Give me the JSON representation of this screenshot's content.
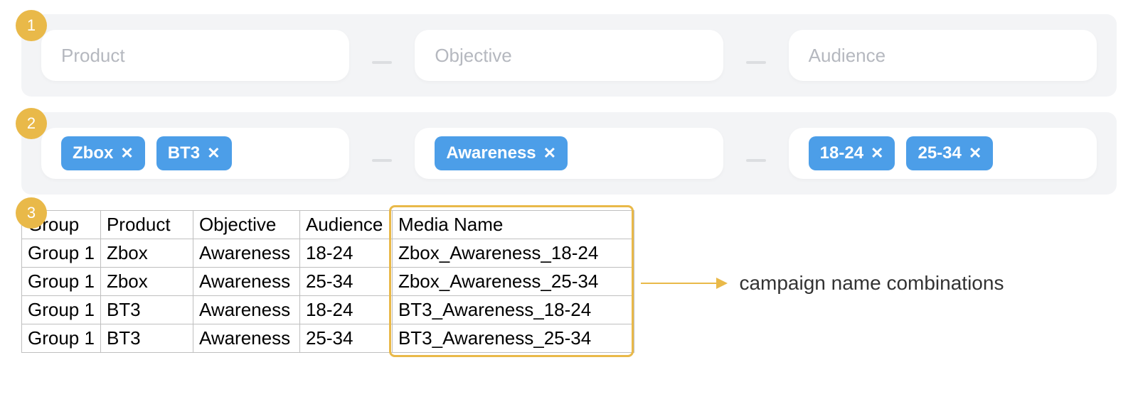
{
  "steps": {
    "s1": "1",
    "s2": "2",
    "s3": "3"
  },
  "row1": {
    "product_ph": "Product",
    "objective_ph": "Objective",
    "audience_ph": "Audience"
  },
  "row2": {
    "product_chips": [
      "Zbox",
      "BT3"
    ],
    "objective_chips": [
      "Awareness"
    ],
    "audience_chips": [
      "18-24",
      "25-34"
    ]
  },
  "table": {
    "headers": {
      "group": "Group",
      "product": "Product",
      "objective": "Objective",
      "audience": "Audience",
      "media": "Media Name"
    },
    "rows": [
      {
        "group": "Group 1",
        "product": "Zbox",
        "objective": "Awareness",
        "audience": "18-24",
        "media": "Zbox_Awareness_18-24"
      },
      {
        "group": "Group 1",
        "product": "Zbox",
        "objective": "Awareness",
        "audience": "25-34",
        "media": "Zbox_Awareness_25-34"
      },
      {
        "group": "Group 1",
        "product": "BT3",
        "objective": "Awareness",
        "audience": "18-24",
        "media": "BT3_Awareness_18-24"
      },
      {
        "group": "Group 1",
        "product": "BT3",
        "objective": "Awareness",
        "audience": "25-34",
        "media": "BT3_Awareness_25-34"
      }
    ]
  },
  "annotation": "campaign name combinations",
  "close_glyph": "✕"
}
